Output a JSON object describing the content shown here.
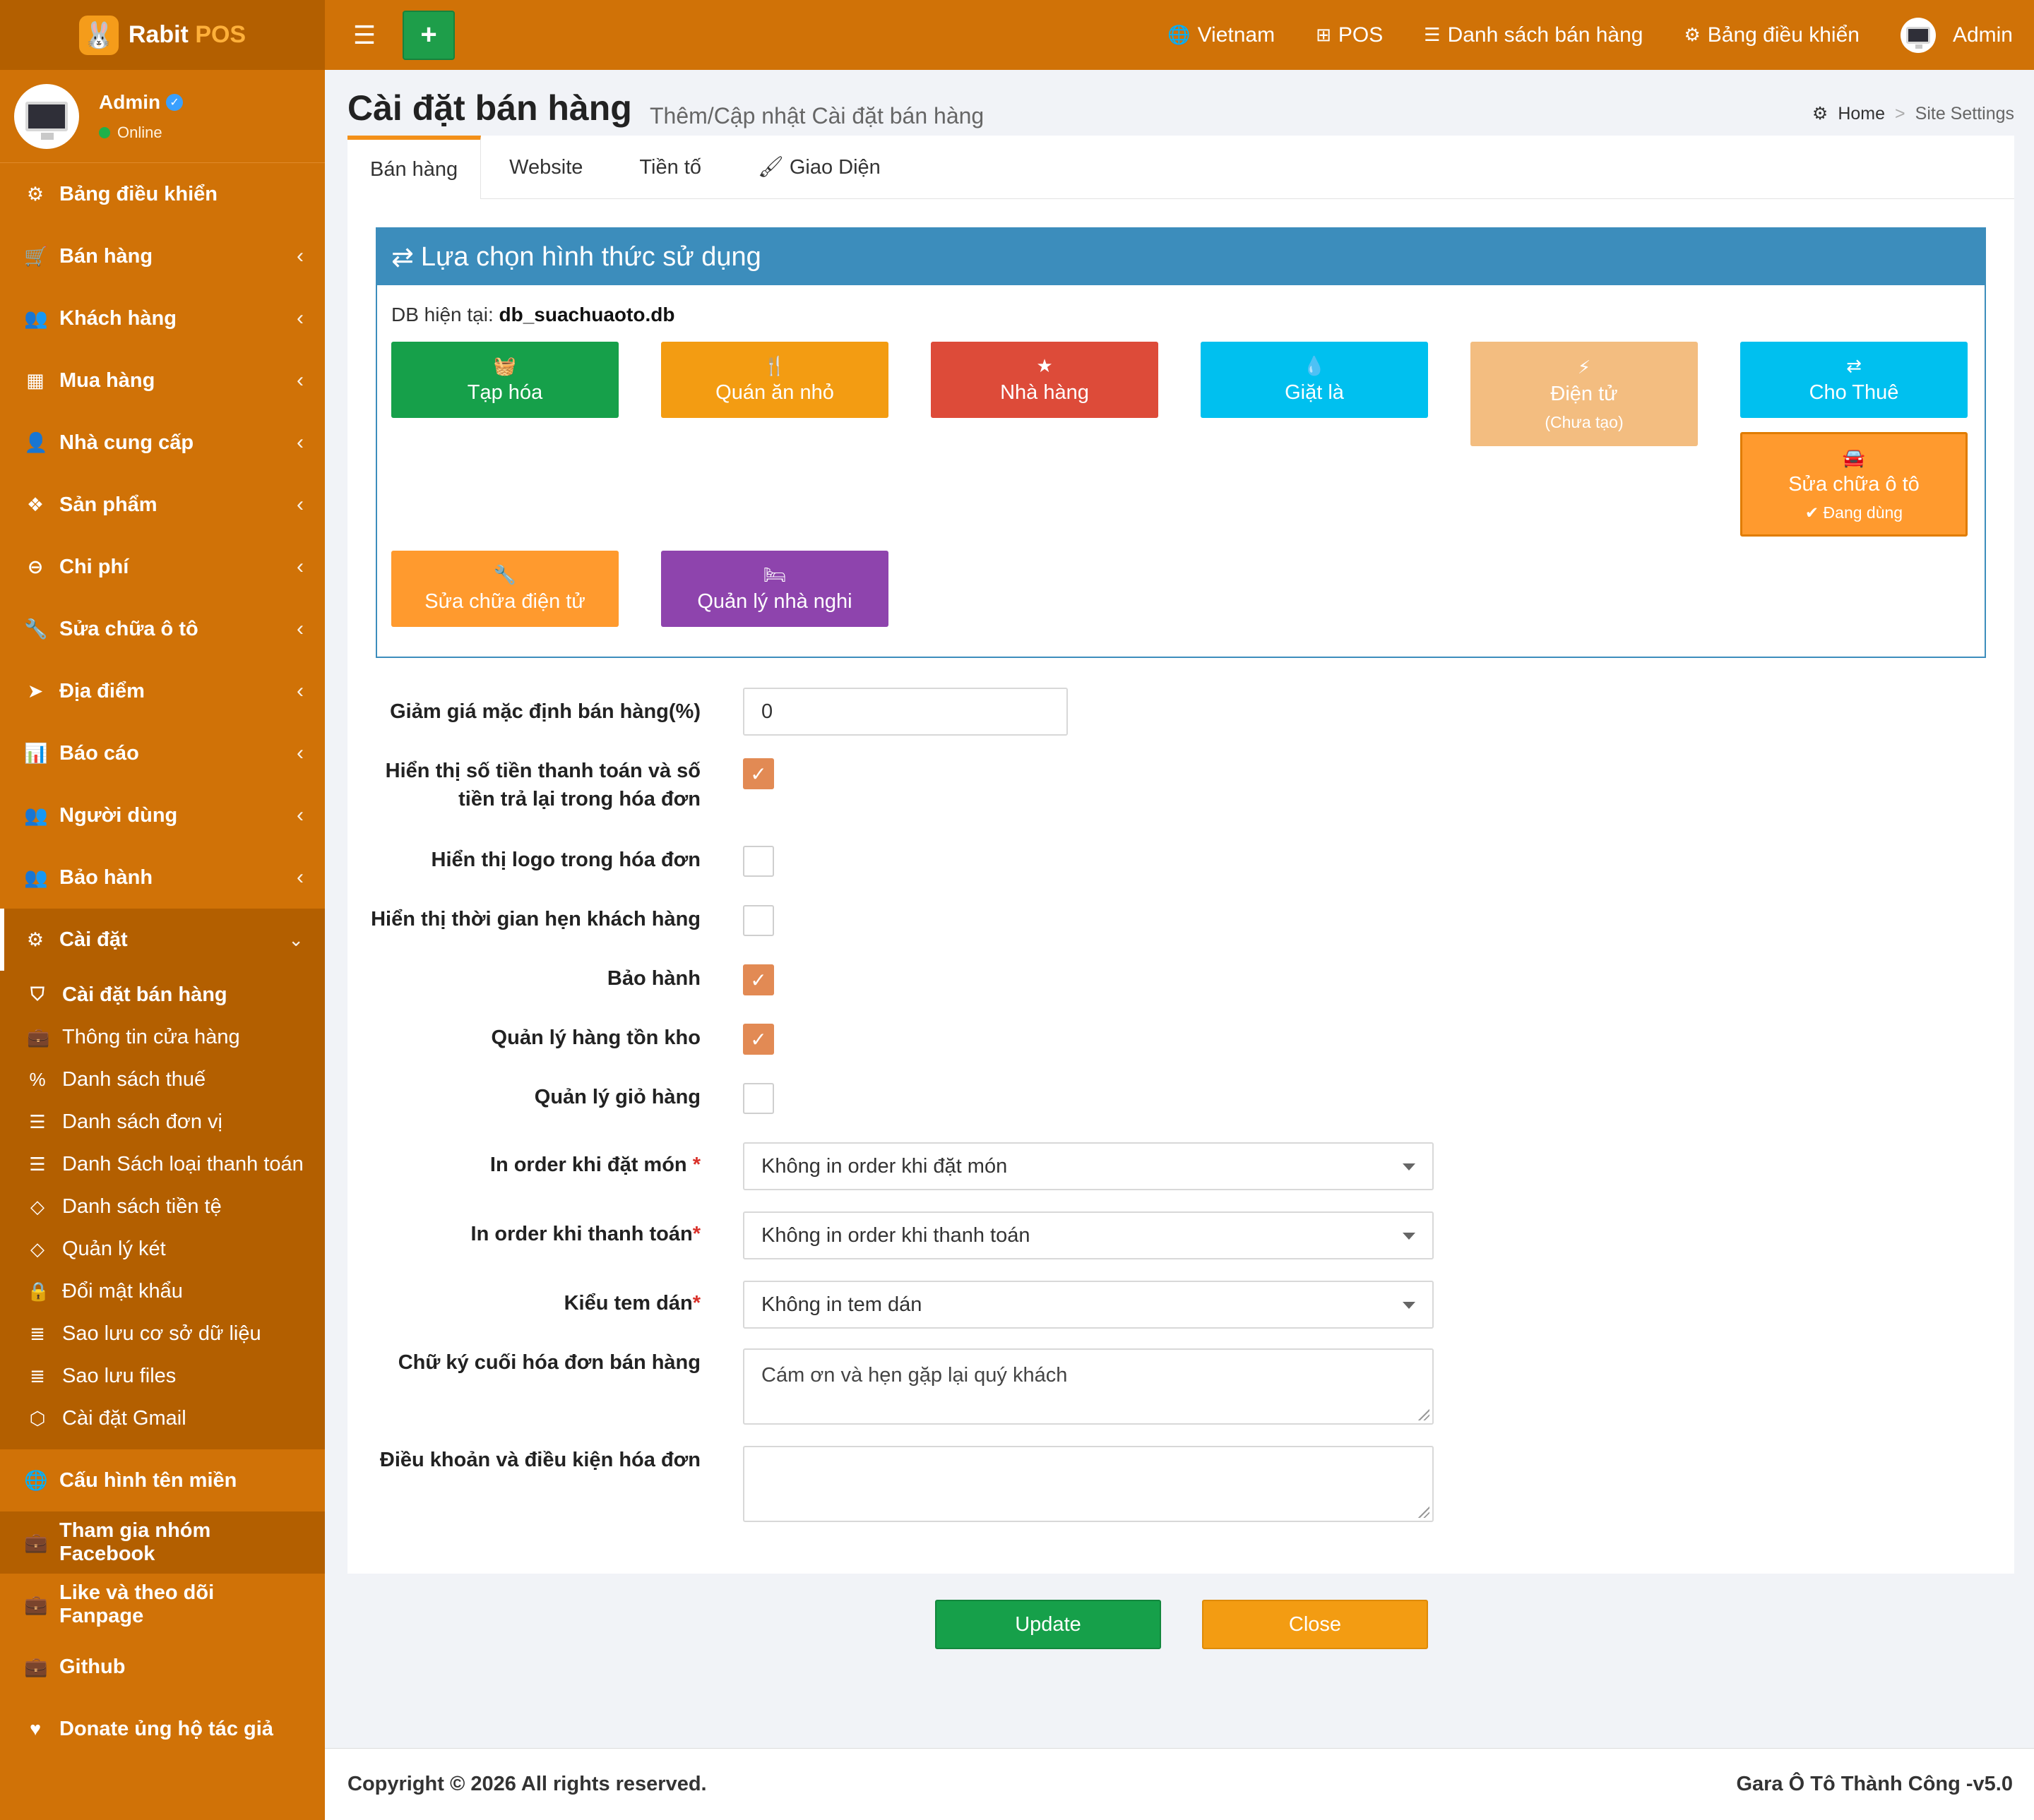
{
  "brand": {
    "name_part1": "Rabit",
    "name_part2": "POS",
    "logo_icon": "rabbit-icon"
  },
  "user": {
    "name": "Admin",
    "status": "Online"
  },
  "sidebar": {
    "items": [
      {
        "label": "Bảng điều khiển",
        "icon": "dashboard-icon",
        "glyph": "⚙"
      },
      {
        "label": "Bán hàng",
        "icon": "cart-icon",
        "glyph": "🛒"
      },
      {
        "label": "Khách hàng",
        "icon": "users-icon",
        "glyph": "👥"
      },
      {
        "label": "Mua hàng",
        "icon": "grid-icon",
        "glyph": "▦"
      },
      {
        "label": "Nhà cung cấp",
        "icon": "user-plus-icon",
        "glyph": "👤"
      },
      {
        "label": "Sản phẩm",
        "icon": "cubes-icon",
        "glyph": "❖"
      },
      {
        "label": "Chi phí",
        "icon": "minus-circle-icon",
        "glyph": "⊖"
      },
      {
        "label": "Sửa chữa ô tô",
        "icon": "wrench-icon",
        "glyph": "🔧"
      },
      {
        "label": "Địa điểm",
        "icon": "location-arrow-icon",
        "glyph": "➤"
      },
      {
        "label": "Báo cáo",
        "icon": "bar-chart-icon",
        "glyph": "📊"
      },
      {
        "label": "Người dùng",
        "icon": "users-icon",
        "glyph": "👥"
      },
      {
        "label": "Bảo hành",
        "icon": "users-icon",
        "glyph": "👥"
      },
      {
        "label": "Cài đặt",
        "icon": "cogs-icon",
        "glyph": "⚙"
      }
    ],
    "submenu": [
      {
        "label": "Cài đặt bán hàng",
        "icon": "shield-icon",
        "glyph": "⛉"
      },
      {
        "label": "Thông tin cửa hàng",
        "icon": "briefcase-icon",
        "glyph": "💼"
      },
      {
        "label": "Danh sách thuế",
        "icon": "percent-icon",
        "glyph": "%"
      },
      {
        "label": "Danh sách đơn vị",
        "icon": "list-icon",
        "glyph": "☰"
      },
      {
        "label": "Danh Sách loại thanh toán",
        "icon": "list-icon",
        "glyph": "☰"
      },
      {
        "label": "Danh sách tiền tệ",
        "icon": "code-icon",
        "glyph": "◇"
      },
      {
        "label": "Quản lý két",
        "icon": "code-icon",
        "glyph": "◇"
      },
      {
        "label": "Đổi mật khẩu",
        "icon": "lock-icon",
        "glyph": "🔒"
      },
      {
        "label": "Sao lưu cơ sở dữ liệu",
        "icon": "database-icon",
        "glyph": "≣"
      },
      {
        "label": "Sao lưu files",
        "icon": "database-icon",
        "glyph": "≣"
      },
      {
        "label": "Cài đặt Gmail",
        "icon": "cube-icon",
        "glyph": "⬡"
      }
    ],
    "extra": [
      {
        "label": "Cấu hình tên miền",
        "icon": "globe-icon",
        "glyph": "🌐"
      },
      {
        "label": "Tham gia nhóm Facebook",
        "icon": "briefcase-icon",
        "glyph": "💼"
      },
      {
        "label": "Like và theo dõi Fanpage",
        "icon": "briefcase-icon",
        "glyph": "💼"
      },
      {
        "label": "Github",
        "icon": "briefcase-icon",
        "glyph": "💼"
      },
      {
        "label": "Donate ủng hộ tác giả",
        "icon": "heart-icon",
        "glyph": "♥"
      }
    ]
  },
  "topbar": {
    "language": "Vietnam",
    "pos": "POS",
    "sales_list": "Danh sách bán hàng",
    "dashboard": "Bảng điều khiển",
    "admin": "Admin"
  },
  "header": {
    "title": "Cài đặt bán hàng",
    "subtitle": "Thêm/Cập nhật Cài đặt bán hàng",
    "breadcrumb_home": "Home",
    "breadcrumb_current": "Site Settings"
  },
  "tabs": [
    {
      "label": "Bán hàng"
    },
    {
      "label": "Website"
    },
    {
      "label": "Tiền tố"
    },
    {
      "label": "Giao Diện"
    }
  ],
  "type_panel": {
    "title": "Lựa chọn hình thức sử dụng",
    "db_label": "DB hiện tại:",
    "db_name": "db_suachuaoto.db",
    "buttons": [
      {
        "label": "Tạp hóa",
        "icon": "basket-icon",
        "glyph": "🧺",
        "color": "#16a04a"
      },
      {
        "label": "Quán ăn nhỏ",
        "icon": "cutlery-icon",
        "glyph": "🍴",
        "color": "#f39c12"
      },
      {
        "label": "Nhà hàng",
        "icon": "star-icon",
        "glyph": "★",
        "color": "#dd4b39"
      },
      {
        "label": "Giặt là",
        "icon": "tint-icon",
        "glyph": "💧",
        "color": "#00c0ef"
      },
      {
        "label": "Điện tử",
        "note": "(Chưa tạo)",
        "icon": "bolt-icon",
        "glyph": "⚡",
        "color": "#f3bd80"
      },
      {
        "label": "Cho Thuê",
        "icon": "exchange-icon",
        "glyph": "⇄",
        "color": "#00c0ef"
      },
      {
        "label": "Sửa chữa ô tô",
        "note": "✔ Đang dùng",
        "icon": "car-icon",
        "glyph": "🚘",
        "color": "#ff9a2e"
      },
      {
        "label": "Sửa chữa điện tử",
        "icon": "wrench-icon",
        "glyph": "🔧",
        "color": "#ff9a2e"
      },
      {
        "label": "Quản lý nhà nghi",
        "icon": "bed-icon",
        "glyph": "🛏",
        "color": "#8e44ad"
      }
    ]
  },
  "form": {
    "discount_label": "Giảm giá mặc định bán hàng(%)",
    "discount_value": "0",
    "show_paid_label_1": "Hiển thị số tiền thanh toán và số",
    "show_paid_label_2": "tiền trả lại trong hóa đơn",
    "show_paid_checked": true,
    "show_logo_label": "Hiển thị logo trong hóa đơn",
    "show_logo_checked": false,
    "show_appt_label": "Hiển thị thời gian hẹn khách hàng",
    "show_appt_checked": false,
    "warranty_label": "Bảo hành",
    "warranty_checked": true,
    "inventory_label": "Quản lý hàng tồn kho",
    "inventory_checked": true,
    "cart_label": "Quản lý giỏ hàng",
    "cart_checked": false,
    "order_on_place_label": "In order khi đặt món",
    "order_on_place_value": "Không in order khi đặt món",
    "order_on_pay_label": "In order khi thanh toán",
    "order_on_pay_value": "Không in order khi thanh toán",
    "sticker_label": "Kiểu tem dán",
    "sticker_value": "Không in tem dán",
    "signature_label": "Chữ ký cuối hóa đơn bán hàng",
    "signature_value": "Cám ơn và hẹn gặp lại quý khách",
    "terms_label": "Điều khoản và điều kiện hóa đơn",
    "terms_value": "",
    "required_mark": "*"
  },
  "actions": {
    "update": "Update",
    "close": "Close"
  },
  "footer": {
    "copyright": "Copyright © 2026 All rights reserved.",
    "version": "Gara Ô Tô Thành Công -v5.0"
  }
}
